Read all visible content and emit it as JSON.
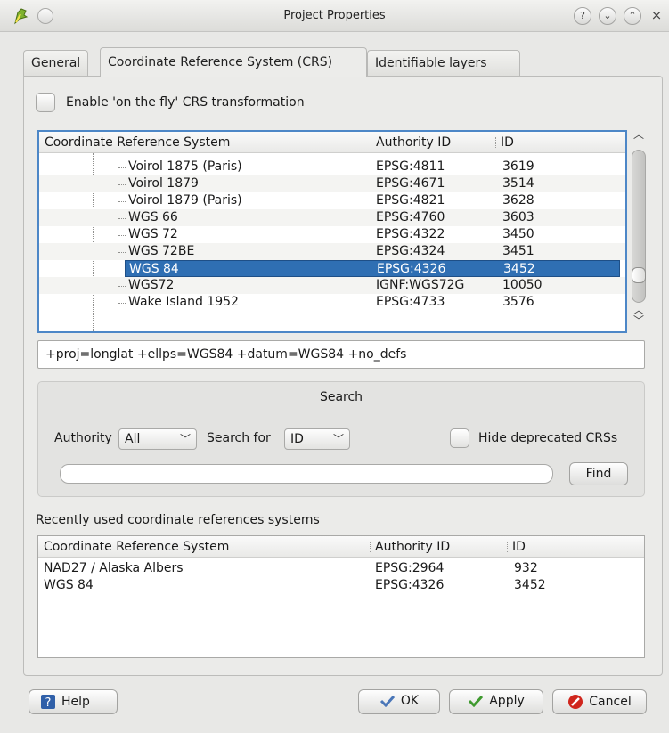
{
  "window": {
    "title": "Project Properties"
  },
  "tabs": [
    {
      "label": "General"
    },
    {
      "label": "Coordinate Reference System (CRS)"
    },
    {
      "label": "Identifiable layers"
    }
  ],
  "otf_checkbox": {
    "label": "Enable 'on the fly' CRS transformation",
    "checked": false
  },
  "crs_tree": {
    "headers": [
      "Coordinate Reference System",
      "Authority ID",
      "ID"
    ],
    "rows": [
      {
        "name": "Voirol 1875 (Paris)",
        "authority": "EPSG:4811",
        "id": "3619"
      },
      {
        "name": "Voirol 1879",
        "authority": "EPSG:4671",
        "id": "3514"
      },
      {
        "name": "Voirol 1879 (Paris)",
        "authority": "EPSG:4821",
        "id": "3628"
      },
      {
        "name": "WGS 66",
        "authority": "EPSG:4760",
        "id": "3603"
      },
      {
        "name": "WGS 72",
        "authority": "EPSG:4322",
        "id": "3450"
      },
      {
        "name": "WGS 72BE",
        "authority": "EPSG:4324",
        "id": "3451"
      },
      {
        "name": "WGS 84",
        "authority": "EPSG:4326",
        "id": "3452",
        "selected": true
      },
      {
        "name": "WGS72",
        "authority": "IGNF:WGS72G",
        "id": "10050"
      },
      {
        "name": "Wake Island 1952",
        "authority": "EPSG:4733",
        "id": "3576"
      }
    ]
  },
  "proj_string": "+proj=longlat +ellps=WGS84 +datum=WGS84 +no_defs",
  "search": {
    "title": "Search",
    "authority_label": "Authority",
    "authority_value": "All",
    "search_for_label": "Search for",
    "search_for_value": "ID",
    "hide_deprecated_label": "Hide deprecated CRSs",
    "hide_deprecated_checked": false,
    "query": "",
    "find_label": "Find"
  },
  "recent": {
    "label": "Recently used coordinate references systems",
    "headers": [
      "Coordinate Reference System",
      "Authority ID",
      "ID"
    ],
    "rows": [
      {
        "name": "NAD27 / Alaska Albers",
        "authority": "EPSG:2964",
        "id": "932"
      },
      {
        "name": "WGS 84",
        "authority": "EPSG:4326",
        "id": "3452"
      }
    ]
  },
  "buttons": {
    "help": "Help",
    "ok": "OK",
    "apply": "Apply",
    "cancel": "Cancel"
  },
  "title_buttons": [
    "?",
    "⌄",
    "⌃",
    "×"
  ],
  "colors": {
    "selection": "#2f6fb3",
    "focus_border": "#4d87c7",
    "ok_check": "#4a76b8",
    "apply_check": "#3f9a2f",
    "cancel_icon": "#d0261d",
    "help_icon": "#2f5fa8"
  }
}
